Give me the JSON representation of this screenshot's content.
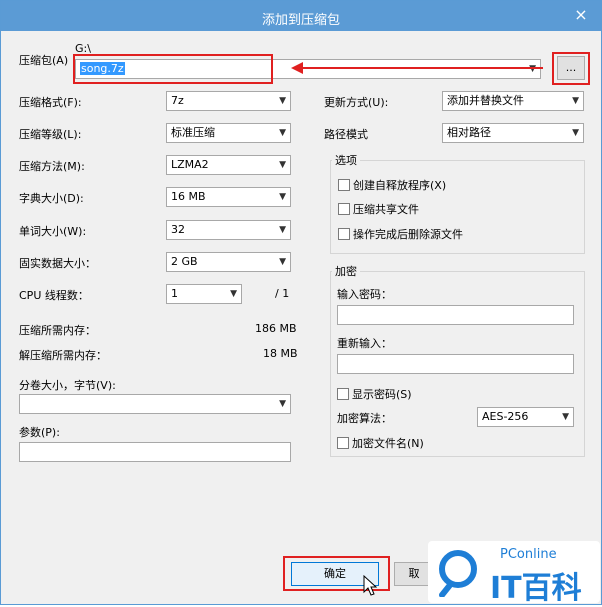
{
  "window": {
    "title": "添加到压缩包",
    "close": "×"
  },
  "archive": {
    "label": "压缩包(A)",
    "path": "G:\\",
    "filename": "song.7z",
    "browse": "..."
  },
  "left": {
    "format": {
      "label": "压缩格式(F):",
      "value": "7z"
    },
    "level": {
      "label": "压缩等级(L):",
      "value": "标准压缩"
    },
    "method": {
      "label": "压缩方法(M):",
      "value": "LZMA2"
    },
    "dict": {
      "label": "字典大小(D):",
      "value": "16 MB"
    },
    "word": {
      "label": "单词大小(W):",
      "value": "32"
    },
    "solid": {
      "label": "固实数据大小：",
      "value": "2 GB"
    },
    "threads": {
      "label": "CPU 线程数：",
      "value": "1",
      "total": "/ 1"
    },
    "mem_compress": {
      "label": "压缩所需内存：",
      "value": "186 MB"
    },
    "mem_decompress": {
      "label": "解压缩所需内存：",
      "value": "18 MB"
    },
    "volume": {
      "label": "分卷大小，字节(V):",
      "value": ""
    },
    "params": {
      "label": "参数(P):",
      "value": ""
    }
  },
  "right": {
    "update": {
      "label": "更新方式(U):",
      "value": "添加并替换文件"
    },
    "pathmode": {
      "label": "路径模式",
      "value": "相对路径"
    },
    "options": {
      "title": "选项",
      "sfx": "创建自释放程序(X)",
      "shared": "压缩共享文件",
      "delete": "操作完成后删除源文件"
    },
    "encryption": {
      "title": "加密",
      "password_label": "输入密码：",
      "reenter_label": "重新输入：",
      "show_password": "显示密码(S)",
      "method_label": "加密算法：",
      "method_value": "AES-256",
      "encrypt_names": "加密文件名(N)"
    }
  },
  "buttons": {
    "ok": "确定",
    "cancel": "取"
  },
  "watermark": {
    "brand": "PConline",
    "name": "IT百科"
  },
  "colors": {
    "titlebar": "#5b9bd5",
    "highlight": "#e02020",
    "selection": "#3399ff"
  }
}
